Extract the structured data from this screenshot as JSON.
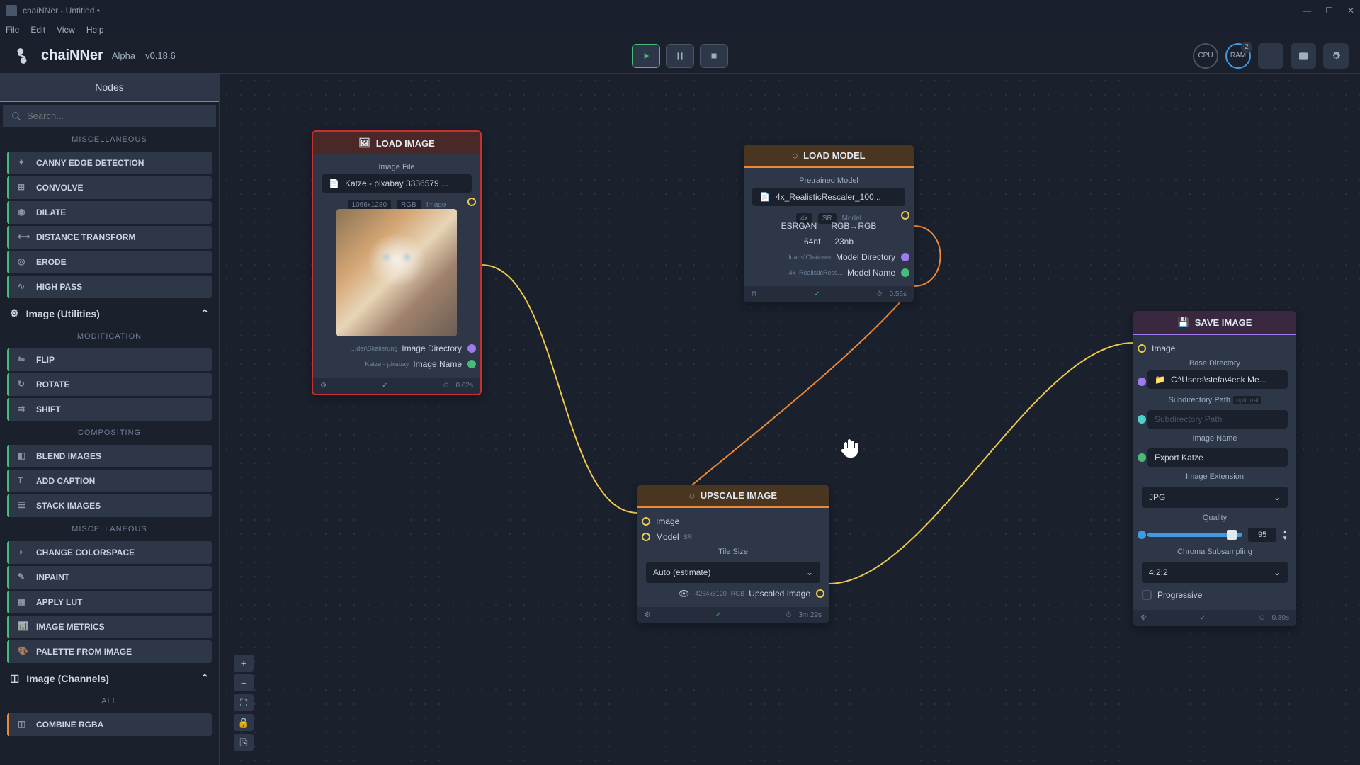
{
  "titlebar": {
    "text": "chaiNNer - Untitled •"
  },
  "menubar": {
    "items": [
      "File",
      "Edit",
      "View",
      "Help"
    ]
  },
  "app": {
    "name": "chaiNNer",
    "stage": "Alpha",
    "version": "v0.18.6"
  },
  "resources": {
    "cpu": "CPU",
    "ram": "RAM",
    "ram_badge": "2"
  },
  "sidebar": {
    "tab": "Nodes",
    "search_placeholder": "Search...",
    "sections": {
      "misc1": "MISCELLANEOUS",
      "modification": "MODIFICATION",
      "compositing": "COMPOSITING",
      "misc2": "MISCELLANEOUS",
      "all": "ALL"
    },
    "cat_utilities": "Image (Utilities)",
    "cat_channels": "Image (Channels)",
    "nodes_misc1": [
      "CANNY EDGE DETECTION",
      "CONVOLVE",
      "DILATE",
      "DISTANCE TRANSFORM",
      "ERODE",
      "HIGH PASS"
    ],
    "nodes_mod": [
      "FLIP",
      "ROTATE",
      "SHIFT"
    ],
    "nodes_comp": [
      "BLEND IMAGES",
      "ADD CAPTION",
      "STACK IMAGES"
    ],
    "nodes_misc2": [
      "CHANGE COLORSPACE",
      "INPAINT",
      "APPLY LUT",
      "IMAGE METRICS",
      "PALETTE FROM IMAGE"
    ],
    "nodes_all": [
      "COMBINE RGBA"
    ]
  },
  "nodes": {
    "load_image": {
      "title": "LOAD IMAGE",
      "file_label": "Image File",
      "file_value": "Katze - pixabay 3336579 ...",
      "info_dims": "1066x1280",
      "info_mode": "RGB",
      "info_type": "Image",
      "dir_small": "...der\\Skalierung",
      "dir_label": "Image Directory",
      "name_small": "Katze - pixabay",
      "name_label": "Image Name",
      "footer_time": "0.02s"
    },
    "load_model": {
      "title": "LOAD MODEL",
      "file_label": "Pretrained Model",
      "file_value": "4x_RealisticRescaler_100...",
      "tag_4x": "4x",
      "tag_sr": "SR",
      "tag_model": "Model",
      "arch": "ESRGAN",
      "channels": "RGB→RGB",
      "nf": "64nf",
      "nb": "23nb",
      "dir_small": "...loads\\Chainner",
      "dir_label": "Model Directory",
      "name_small": "4x_RealisticResc...",
      "name_label": "Model Name",
      "footer_time": "0.56s"
    },
    "upscale": {
      "title": "UPSCALE IMAGE",
      "in_image": "Image",
      "in_model": "Model",
      "in_model_tag": "SR",
      "tile_label": "Tile Size",
      "tile_value": "Auto (estimate)",
      "out_dims": "4264x5120",
      "out_mode": "RGB",
      "out_label": "Upscaled Image",
      "footer_time": "3m 29s"
    },
    "save": {
      "title": "SAVE IMAGE",
      "in_image": "Image",
      "dir_label": "Base Directory",
      "dir_value": "C:\\Users\\stefa\\4eck Me...",
      "subdir_label": "Subdirectory Path",
      "subdir_opt": "optional",
      "subdir_placeholder": "Subdirectory Path",
      "name_label": "Image Name",
      "name_value": "Export Katze",
      "ext_label": "Image Extension",
      "ext_value": "JPG",
      "quality_label": "Quality",
      "quality_value": "95",
      "chroma_label": "Chroma Subsampling",
      "chroma_value": "4:2:2",
      "progressive": "Progressive",
      "footer_time": "0.80s"
    }
  }
}
